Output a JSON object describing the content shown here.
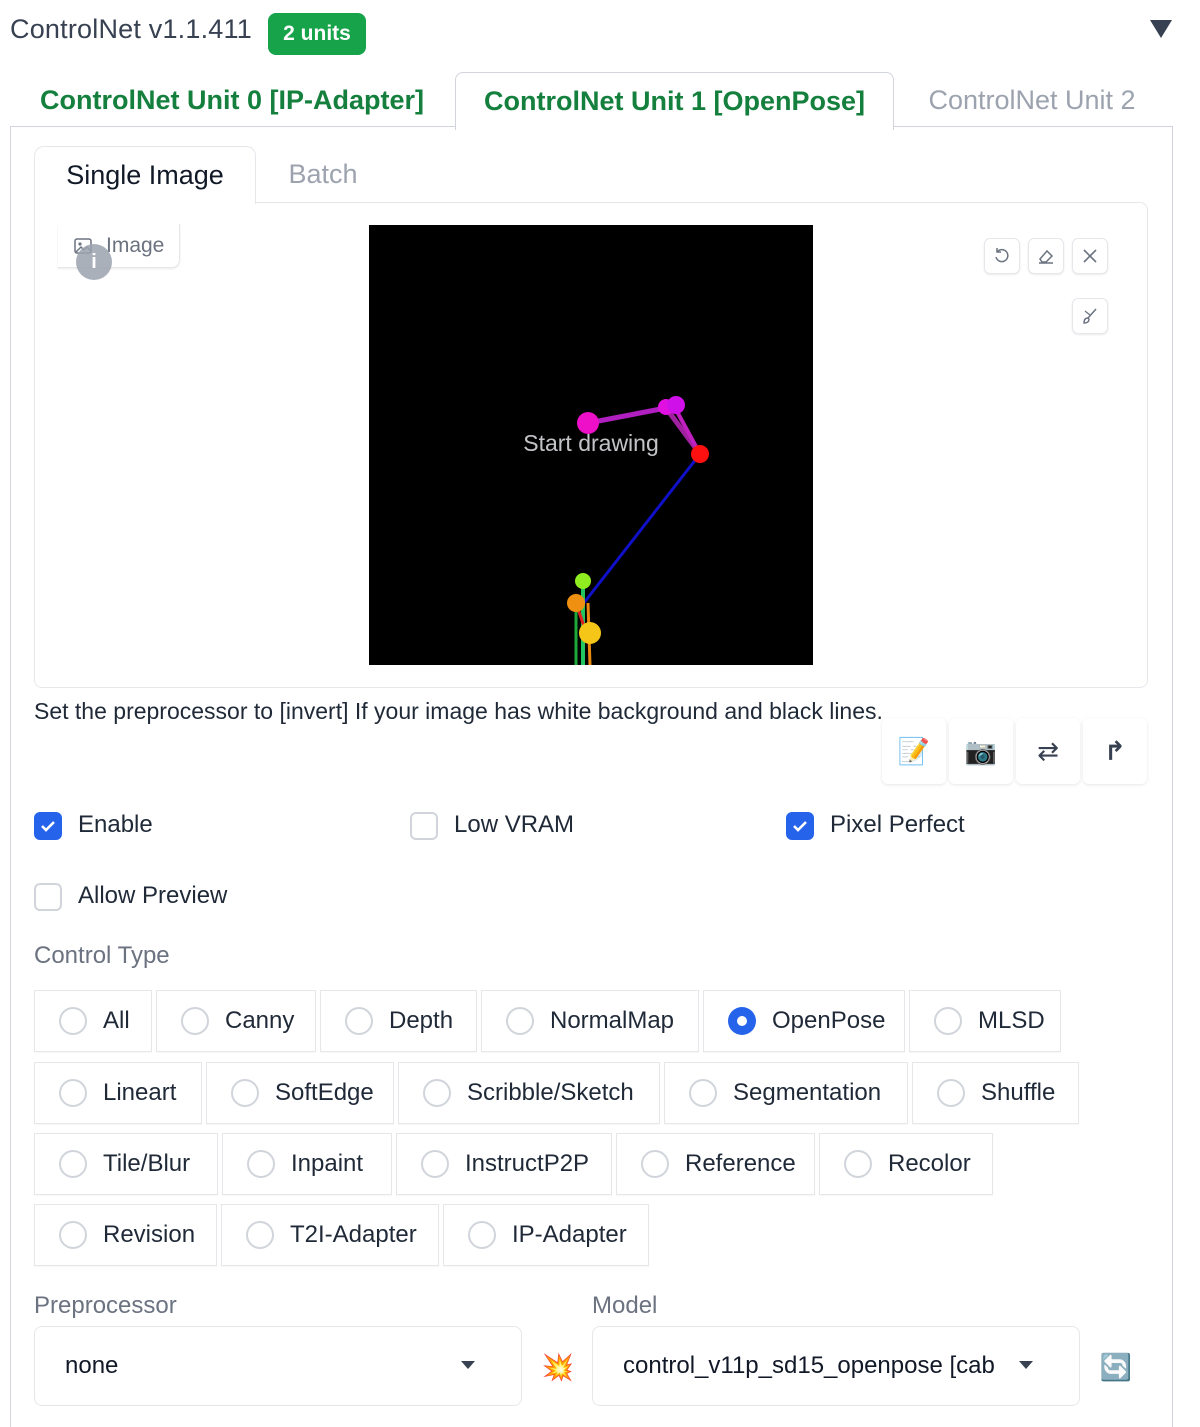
{
  "header": {
    "title": "ControlNet v1.1.411",
    "badge": "2 units"
  },
  "unit_tabs": [
    {
      "label": "ControlNet Unit 0 [IP-Adapter]",
      "state": "inactive"
    },
    {
      "label": "ControlNet Unit 1 [OpenPose]",
      "state": "active"
    },
    {
      "label": "ControlNet Unit 2",
      "state": "inactive"
    }
  ],
  "image_tabs": [
    {
      "label": "Single Image",
      "state": "active"
    },
    {
      "label": "Batch",
      "state": "inactive"
    }
  ],
  "image_panel": {
    "label": "Image",
    "canvas_hint": "Start drawing",
    "info_glyph": "i",
    "tools": [
      "undo-icon",
      "eraser-icon",
      "close-icon",
      "brush-icon"
    ]
  },
  "hint": "Set the preprocessor to [invert] If your image has white background and black lines.",
  "action_buttons": [
    {
      "icon": "memo-icon",
      "glyph": "📝"
    },
    {
      "icon": "camera-icon",
      "glyph": "📷"
    },
    {
      "icon": "swap-icon",
      "glyph": "⇄"
    },
    {
      "icon": "upload-arrow-icon",
      "glyph": "↱"
    }
  ],
  "checkboxes": {
    "enable": {
      "label": "Enable",
      "checked": true
    },
    "low_vram": {
      "label": "Low VRAM",
      "checked": false
    },
    "pixel_perfect": {
      "label": "Pixel Perfect",
      "checked": true
    },
    "allow_preview": {
      "label": "Allow Preview",
      "checked": false
    }
  },
  "control_type": {
    "label": "Control Type",
    "selected": "OpenPose",
    "options": [
      "All",
      "Canny",
      "Depth",
      "NormalMap",
      "OpenPose",
      "MLSD",
      "Lineart",
      "SoftEdge",
      "Scribble/Sketch",
      "Segmentation",
      "Shuffle",
      "Tile/Blur",
      "Inpaint",
      "InstructP2P",
      "Reference",
      "Recolor",
      "Revision",
      "T2I-Adapter",
      "IP-Adapter"
    ]
  },
  "preprocessor": {
    "label": "Preprocessor",
    "value": "none"
  },
  "run_icon": "💥",
  "model": {
    "label": "Model",
    "value": "control_v11p_sd15_openpose [cab"
  },
  "refresh_icon": "🔄",
  "colors": {
    "accent_green": "#16a34a",
    "tab_green": "#15803d",
    "accent_blue": "#2563eb"
  }
}
